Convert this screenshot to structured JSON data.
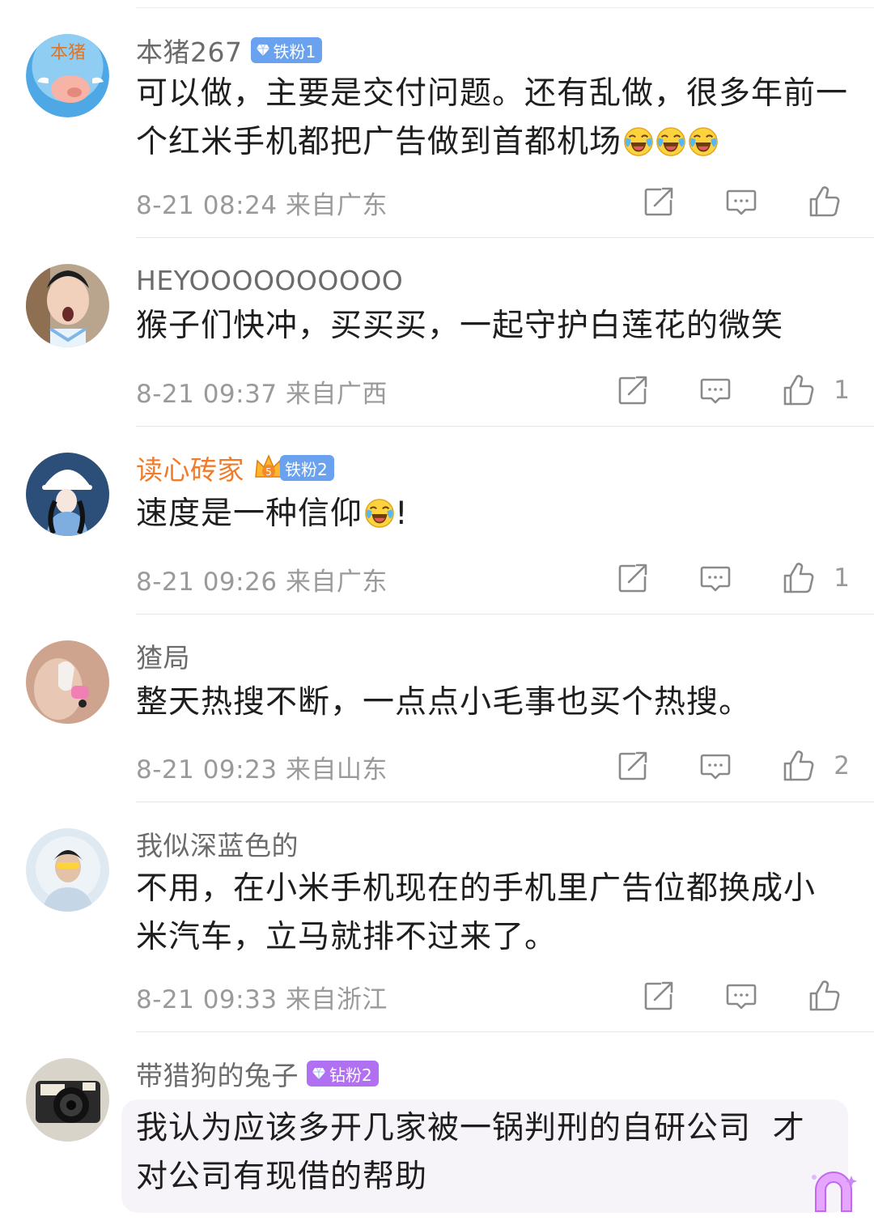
{
  "comments": [
    {
      "username": "本猪267",
      "badge": "铁粉1",
      "text_lines": [
        "可以做，主要是交付问题。还有乱做，很多年前一",
        "个红米手机都把广告做到首都机场"
      ],
      "emoji_count": 3,
      "time": "8-21 08:24",
      "location": "来自广东",
      "likes": ""
    },
    {
      "username": "HEYOOOOOOOOOO",
      "badge": "",
      "text_lines": [
        "猴子们快冲，买买买，一起守护白莲花的微笑"
      ],
      "time": "8-21 09:37",
      "location": "来自广西",
      "likes": "1"
    },
    {
      "username": "读心砖家",
      "badge": "铁粉2",
      "text_lines": [
        "速度是一种信仰"
      ],
      "text_suffix": "!",
      "time": "8-21 09:26",
      "location": "来自广东",
      "likes": "1"
    },
    {
      "username": "猹局",
      "badge": "",
      "text_lines": [
        "整天热搜不断，一点点小毛事也买个热搜。"
      ],
      "time": "8-21 09:23",
      "location": "来自山东",
      "likes": "2"
    },
    {
      "username": "我似深蓝色的",
      "badge": "",
      "text_lines": [
        "不用，在小米手机现在的手机里广告位都换成小",
        "米汽车，立马就排不过来了。"
      ],
      "time": "8-21 09:33",
      "location": "来自浙江",
      "likes": ""
    },
    {
      "username": "带猎狗的兔子",
      "badge": "钻粉2",
      "text_lines": [
        "我认为应该多开几家被一锅判刑的自研公司  才",
        "对公司有现借的帮助"
      ]
    }
  ],
  "avatar_lettering": {
    "c1": "本猪"
  },
  "icons": {
    "share": "share-icon",
    "comment": "comment-icon",
    "like": "thumbs-up-icon",
    "emoji": "laugh-cry-emoji-icon",
    "badge_gem": "diamond-icon",
    "crown": "crown-icon"
  },
  "colors": {
    "vip_name": "#f07b2a",
    "iron_badge": "#6aa2ef",
    "diamond_badge": "#b16ff2",
    "meta_text": "#9a9a9a"
  }
}
